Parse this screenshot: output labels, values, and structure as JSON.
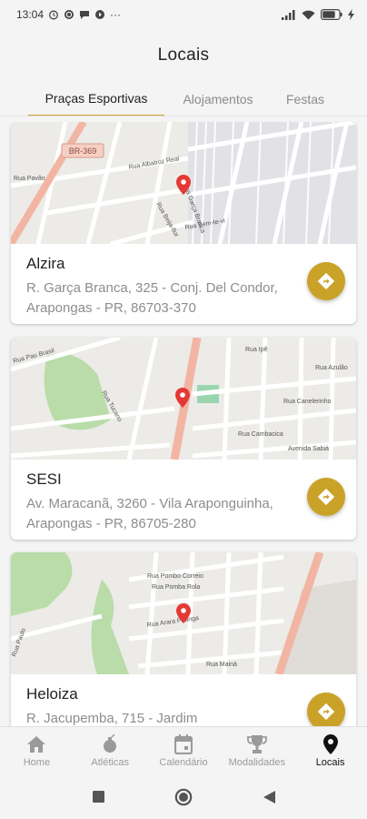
{
  "status_bar": {
    "time": "13:04",
    "left_icons": [
      "alarm-icon",
      "whatsapp-icon",
      "chat-icon",
      "media-icon"
    ],
    "overflow": "···",
    "right_icons": [
      "signal-icon",
      "wifi-icon",
      "battery-icon",
      "charging-icon"
    ]
  },
  "header": {
    "title": "Locais"
  },
  "tabs": [
    {
      "label": "Praças Esportivas",
      "active": true
    },
    {
      "label": "Alojamentos",
      "active": false
    },
    {
      "label": "Festas",
      "active": false
    }
  ],
  "places": [
    {
      "name": "Alzira",
      "address_line1": "R. Garça Branca, 325 - Conj. Del Condor,",
      "address_line2": "Arapongas - PR, 86703-370",
      "map_labels": [
        "BR-369",
        "Rua Pavão",
        "Rua Albatroz Real",
        "Rua Garça Branca",
        "Rua Beija-flor",
        "Rua Bem-te-vi"
      ]
    },
    {
      "name": "SESI",
      "address_line1": "Av. Maracanã, 3260 - Vila Araponguinha,",
      "address_line2": "Arapongas - PR, 86705-280",
      "map_labels": [
        "Rua Pau Brasil",
        "Rua Ipê",
        "Rua Azulão",
        "Rua Canelerinho",
        "Rua Cambacica",
        "Avenida Sabiá",
        "Rua Tucano"
      ]
    },
    {
      "name": "Heloiza",
      "address_line1": "R. Jacupemba, 715 - Jardim",
      "address_line2": "",
      "map_labels": [
        "Rua Pombo Correio",
        "Rua Pomba Rola",
        "Rua Arara Piranga",
        "Rua Mainá",
        "Rua Paulo"
      ]
    }
  ],
  "bottom_nav": [
    {
      "label": "Home",
      "icon": "home-icon",
      "active": false
    },
    {
      "label": "Atléticas",
      "icon": "bomb-icon",
      "active": false
    },
    {
      "label": "Calendário",
      "icon": "calendar-icon",
      "active": false
    },
    {
      "label": "Modalidades",
      "icon": "trophy-icon",
      "active": false
    },
    {
      "label": "Locais",
      "icon": "location-pin-icon",
      "active": true
    }
  ],
  "colors": {
    "accent": "#c9a227",
    "marker": "#e53935",
    "road_major": "#f2b5a4",
    "park": "#b9dca8",
    "background": "#f4f4f4"
  }
}
